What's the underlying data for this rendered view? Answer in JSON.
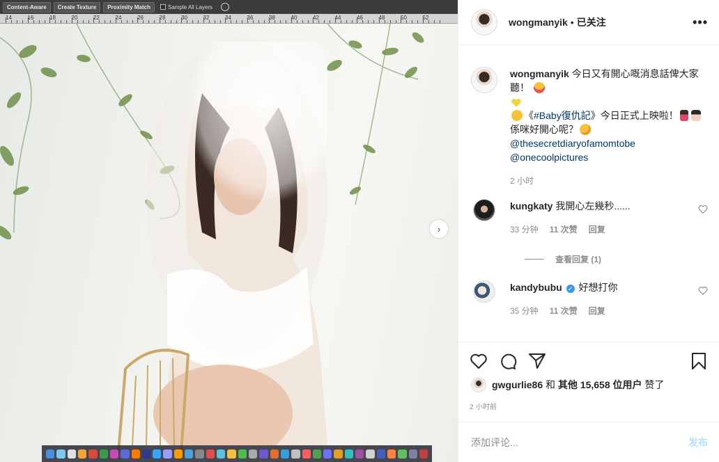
{
  "photoshop": {
    "buttons": [
      "Content-Aware",
      "Create Texture",
      "Proximity Match"
    ],
    "checkbox_label": "Sample All Layers",
    "ruler_ticks": [
      "14",
      "16",
      "18",
      "20",
      "22",
      "24",
      "26",
      "28",
      "30",
      "32",
      "34",
      "36",
      "38",
      "40",
      "42",
      "44",
      "46",
      "48",
      "50",
      "52"
    ]
  },
  "post": {
    "username": "wongmanyik",
    "dot": "•",
    "follow_status": "已关注",
    "more": "•••"
  },
  "caption": {
    "username": "wongmanyik",
    "line1": "今日又有開心嘅消息話俾大家聽！",
    "line3a": "《",
    "hashtag": "#Baby復仇記",
    "line3b": "》今日正式上映啦！",
    "line3c": "係咪好開心呢？",
    "mention1": "@thesecretdiaryofamomtobe",
    "mention2": "@onecoolpictures",
    "time": "2 小时"
  },
  "comments": [
    {
      "username": "kungkaty",
      "text": "我開心左幾秒......",
      "time": "33 分钟",
      "likes": "11 次赞",
      "reply": "回复"
    },
    {
      "username": "kandybubu",
      "text": "好想打你",
      "time": "35 分钟",
      "likes": "11 次赞",
      "reply": "回复"
    }
  ],
  "view_replies": "查看回复 (1)",
  "likes": {
    "user": "gwgurlie86",
    "and": "和",
    "others": "其他",
    "count": "15,658",
    "suffix": "位用户",
    "liked": "赞了"
  },
  "post_time": "2 小时前",
  "add_comment": {
    "placeholder": "添加评论...",
    "post_label": "发布"
  }
}
